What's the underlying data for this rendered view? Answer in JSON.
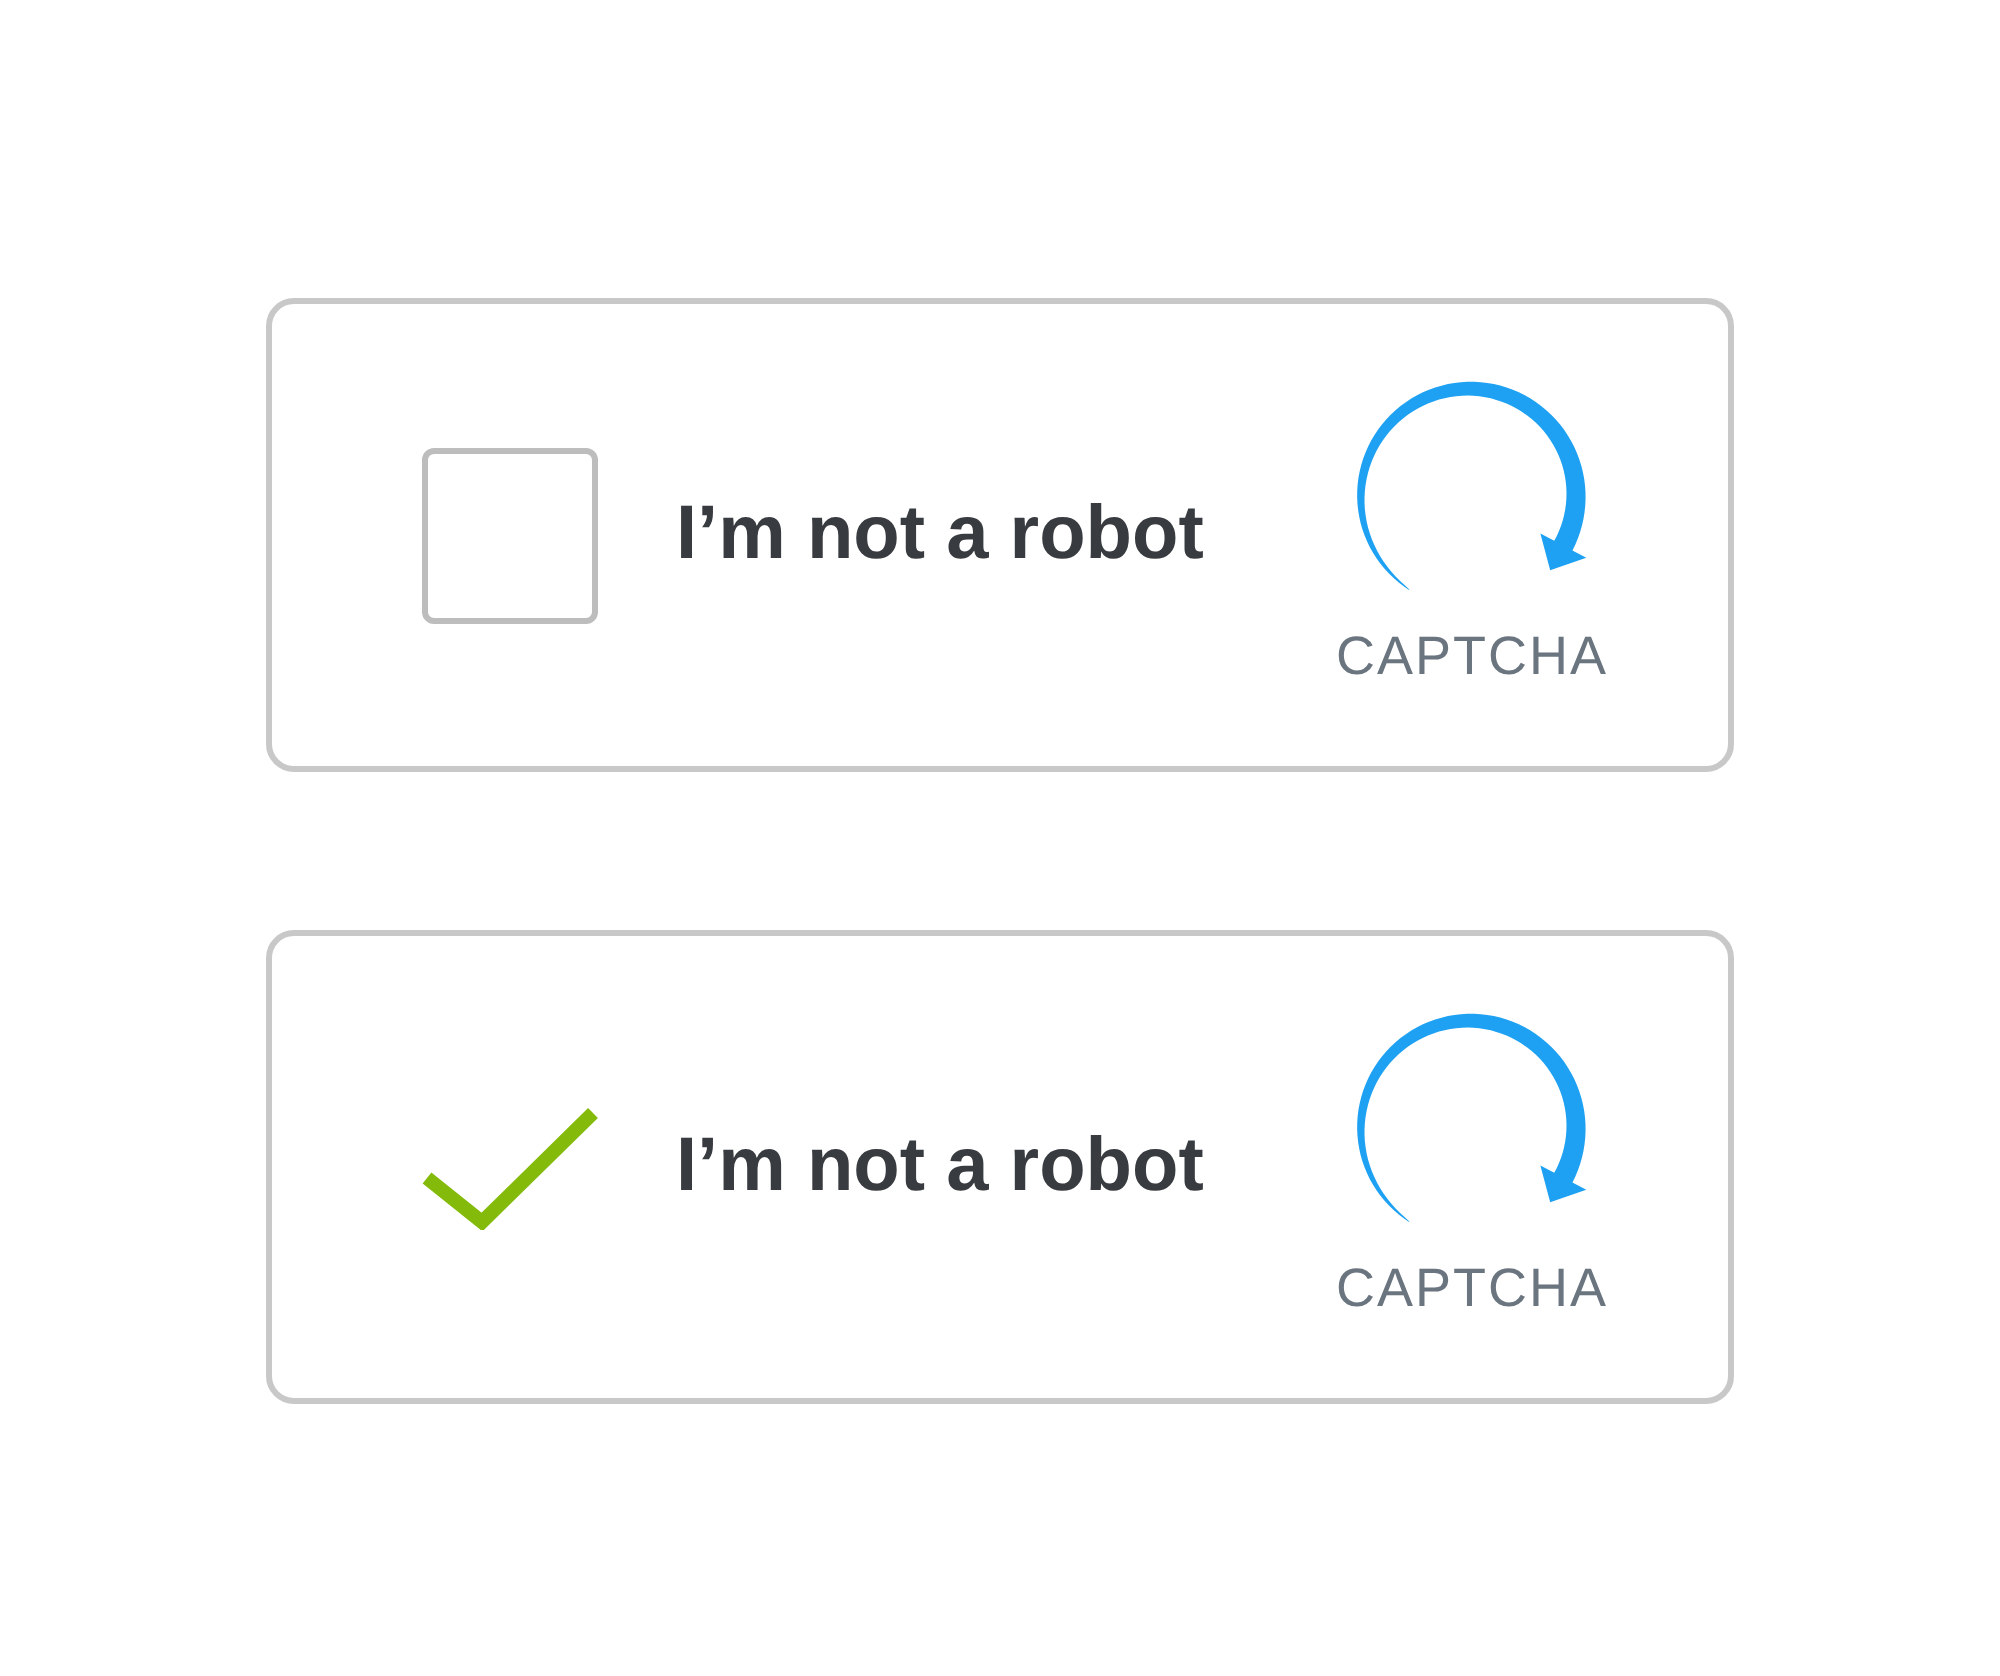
{
  "captchas": [
    {
      "checked": false,
      "label": "I’m not a robot",
      "brand": "CAPTCHA"
    },
    {
      "checked": true,
      "label": "I’m not a robot",
      "brand": "CAPTCHA"
    }
  ]
}
